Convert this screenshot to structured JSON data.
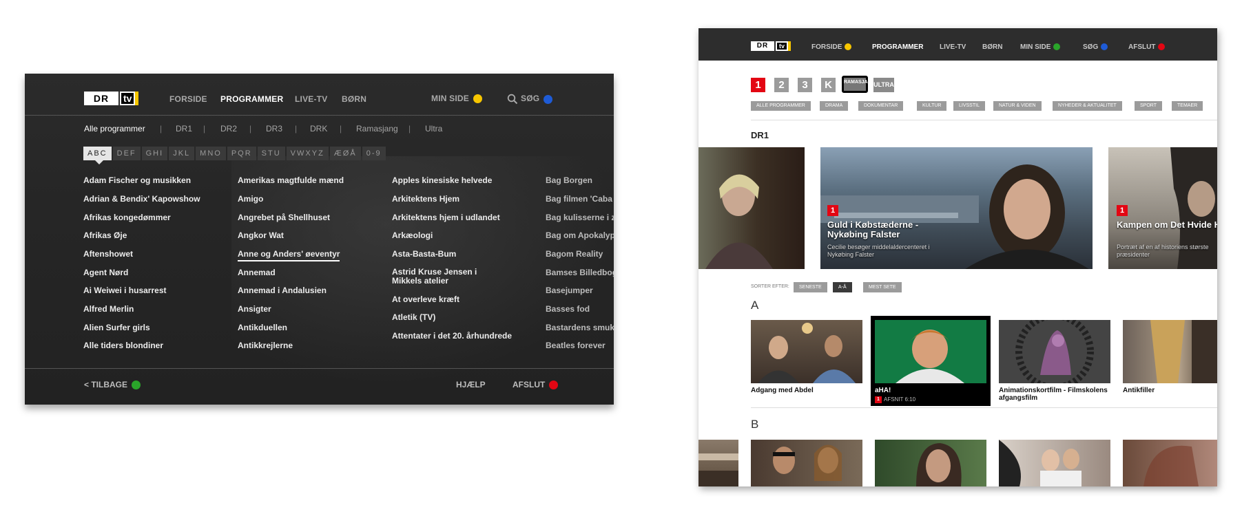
{
  "tv": {
    "logo": {
      "dr": "DR",
      "tv": "tv"
    },
    "nav": [
      "FORSIDE",
      "PROGRAMMER",
      "LIVE-TV",
      "BØRN"
    ],
    "min_side": "MIN SIDE",
    "search": "SØG",
    "channels": [
      "Alle programmer",
      "DR1",
      "DR2",
      "DR3",
      "DRK",
      "Ramasjang",
      "Ultra"
    ],
    "letters": [
      "ABC",
      "DEF",
      "GHI",
      "JKL",
      "MNO",
      "PQR",
      "STU",
      "VWXYZ",
      "ÆØÅ",
      "0-9"
    ],
    "columns": [
      [
        "Adam Fischer og musikken",
        "Adrian & Bendix' Kapowshow",
        "Afrikas kongedømmer",
        "Afrikas Øje",
        "Aftenshowet",
        "Agent Nørd",
        "Ai Weiwei i husarrest",
        "Alfred Merlin",
        "Alien Surfer girls",
        "Alle tiders blondiner"
      ],
      [
        "Amerikas magtfulde mænd",
        "Amigo",
        "Angrebet på Shellhuset",
        "Angkor Wat",
        "Anne og Anders' øeventyr",
        "Annemad",
        "Annemad i Andalusien",
        "Ansigter",
        "Antikduellen",
        "Antikkrejlerne"
      ],
      [
        "Apples kinesiske helvede",
        "Arkitektens Hjem",
        "Arkitektens hjem i udlandet",
        "Arkæologi",
        "Asta-Basta-Bum",
        "Astrid Kruse Jensen i Mikkels atelier",
        "At overleve kræft",
        "Atletik (TV)",
        "Attentater i det 20. århundrede"
      ],
      [
        "Bag Borgen",
        "Bag filmen 'Caba",
        "Bag kulisserne i z",
        "Bag om Apokalyp",
        "Bagom Reality",
        "Bamses Billedbog",
        "Basejumper",
        "Basses fod",
        "Bastardens smukk",
        "Beatles forever"
      ]
    ],
    "footer": {
      "back": "< TILBAGE",
      "help": "HJÆLP",
      "exit": "AFSLUT"
    }
  },
  "web": {
    "logo": {
      "dr": "DR",
      "tv": "tv"
    },
    "nav": [
      "FORSIDE",
      "PROGRAMMER",
      "LIVE-TV",
      "BØRN",
      "MIN SIDE",
      "SØG",
      "AFSLUT"
    ],
    "channels": [
      "1",
      "2",
      "3",
      "K",
      "RAMASJANG",
      "ULTRA"
    ],
    "categories": [
      "ALLE PROGRAMMER",
      "DRAMA",
      "DOKUMENTAR",
      "KULTUR",
      "LIVSSTIL",
      "NATUR & VIDEN",
      "NYHEDER & AKTUALITET",
      "SPORT",
      "TEMAER"
    ],
    "section": "DR1",
    "heroes": [
      {
        "badge": "1",
        "title": "Guld i Købstæderne - Nykøbing Falster",
        "subtitle": "Cecilie besøger middelaldercenteret i Nykøbing Falster"
      },
      {
        "badge": "1",
        "title": "Kampen om Det Hvide Hus: Lincoln vs. Douglas",
        "subtitle": "Portræt af en af historiens største præsidenter"
      }
    ],
    "sort": {
      "label": "SORTER EFTER:",
      "options": [
        "SENESTE",
        "A-Å",
        "MEST SETE"
      ]
    },
    "group_a": {
      "letter": "A",
      "tiles": [
        {
          "title": "Adgang med Abdel"
        },
        {
          "title": "aHA!",
          "meta": "AFSNIT 6:10",
          "badge": "1"
        },
        {
          "title": "Animationskortfilm - Filmskolens afgangsfilm"
        },
        {
          "title": "Antikfiller"
        }
      ]
    },
    "group_b": {
      "letter": "B"
    }
  },
  "colors": {
    "yellow": "#f7c600",
    "blue": "#1e5bd6",
    "green": "#2aa52a",
    "red": "#e30613"
  }
}
